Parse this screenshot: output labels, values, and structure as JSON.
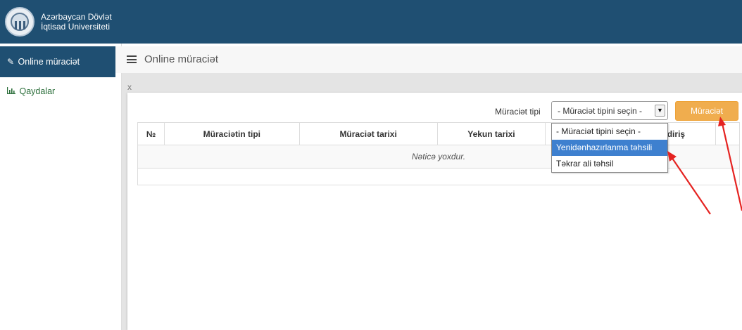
{
  "brand": {
    "line1": "Azərbaycan Dövlət",
    "line2": "İqtisad Universiteti"
  },
  "sidebar": {
    "items": [
      {
        "label": "Online müraciət",
        "icon": "edit-icon"
      },
      {
        "label": "Qaydalar",
        "icon": "bar-chart-icon"
      }
    ]
  },
  "header": {
    "title": "Online müraciət",
    "icon": "hamburger-menu-icon"
  },
  "panel": {
    "close_label": "x",
    "filter_label": "Müraciət tipi",
    "select_value": "- Müraciət tipini seçin -",
    "submit_label": "Müraciət",
    "submit_color": "#f0ad4e"
  },
  "table": {
    "headers": [
      "№",
      "Müraciətin tipi",
      "Müraciət tarixi",
      "Yekun tarixi",
      "",
      "ildiriş",
      ""
    ],
    "empty_message": "Nəticə yoxdur."
  },
  "dropdown": {
    "options": [
      "- Müraciət tipini seçin -",
      "Yenidənhazırlanma təhsili",
      "Təkrar ali təhsil"
    ],
    "highlight_color": "#3e80cf"
  },
  "colors": {
    "topbar": "#1f4f72",
    "annotation_arrow": "#e52321"
  }
}
